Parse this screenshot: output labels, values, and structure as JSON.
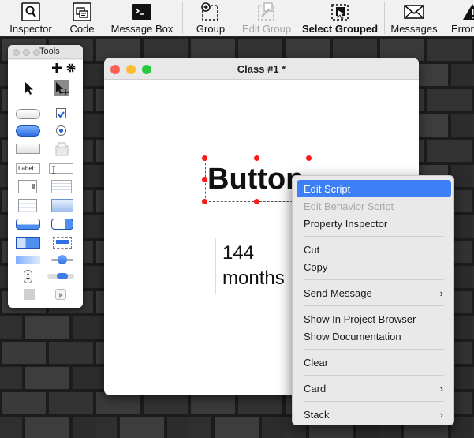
{
  "toolbar": {
    "items": [
      {
        "label": "Inspector",
        "icon": "inspector-icon"
      },
      {
        "label": "Code",
        "icon": "code-icon"
      },
      {
        "label": "Message Box",
        "icon": "message-box-icon"
      },
      {
        "label": "Group",
        "icon": "group-icon"
      },
      {
        "label": "Edit Group",
        "icon": "edit-group-icon"
      },
      {
        "label": "Select Grouped",
        "icon": "select-grouped-icon"
      },
      {
        "label": "Messages",
        "icon": "messages-icon"
      },
      {
        "label": "Errors",
        "icon": "errors-icon"
      }
    ]
  },
  "tools_palette": {
    "title": "Tools",
    "label_tool_text": "Label:"
  },
  "window": {
    "title": "Class #1 *"
  },
  "canvas": {
    "button_text": "Button",
    "field_line1": "144",
    "field_line2": "months"
  },
  "context_menu": {
    "items": [
      {
        "label": "Edit Script"
      },
      {
        "label": "Edit Behavior Script"
      },
      {
        "label": "Property Inspector"
      },
      {
        "label": "Cut"
      },
      {
        "label": "Copy"
      },
      {
        "label": "Send Message"
      },
      {
        "label": "Show In Project Browser"
      },
      {
        "label": "Show Documentation"
      },
      {
        "label": "Clear"
      },
      {
        "label": "Card"
      },
      {
        "label": "Stack"
      }
    ],
    "highlight_color": "#3d7ff6"
  },
  "colors": {
    "close": "#fe5f57",
    "minimize": "#febc2e",
    "zoom": "#28c840",
    "selection_handle": "#ff1a1a"
  }
}
